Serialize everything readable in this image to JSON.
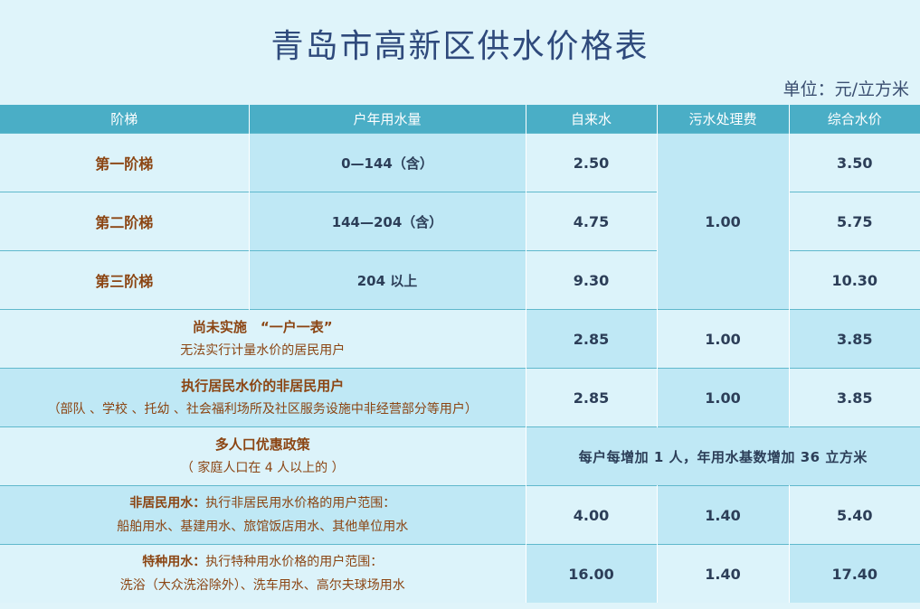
{
  "page": {
    "title": "青岛市高新区供水价格表",
    "unit": "单位：元/立方米"
  },
  "table": {
    "headers": [
      "阶梯",
      "户年用水量",
      "自来水",
      "污水处理费",
      "综合水价"
    ],
    "tiers": [
      {
        "name": "第一阶梯",
        "range": "0—144（含）",
        "tap": "2.50",
        "total": "3.50"
      },
      {
        "name": "第二阶梯",
        "range": "144—204（含）",
        "tap": "4.75",
        "total": "5.75"
      },
      {
        "name": "第三阶梯",
        "range": "204 以上",
        "tap": "9.30",
        "total": "10.30"
      }
    ],
    "tier_sewage": "1.00",
    "rows": {
      "no_meter": {
        "title": "尚未实施　“一户一表”",
        "subtitle": "无法实行计量水价的居民用户",
        "tap": "2.85",
        "sewage": "1.00",
        "total": "3.85"
      },
      "non_resident_using_resident": {
        "title": "执行居民水价的非居民用户",
        "subtitle": "（部队 、学校 、托幼 、社会福利场所及社区服务设施中非经营部分等用户）",
        "tap": "2.85",
        "sewage": "1.00",
        "total": "3.85"
      },
      "large_household": {
        "title": "多人口优惠政策",
        "subtitle": "（ 家庭人口在 4 人以上的 ）",
        "policy": "每户每增加  1 人，年用水基数增加  36 立方米"
      },
      "non_resident": {
        "label": "非居民用水：",
        "desc": "执行非居民用水价格的用户范围：",
        "examples": "船舶用水、基建用水、旅馆饭店用水、其他单位用水",
        "tap": "4.00",
        "sewage": "1.40",
        "total": "5.40"
      },
      "special": {
        "label": "特种用水：",
        "desc": "执行特种用水价格的用户范围：",
        "examples": "洗浴（大众洗浴除外）、洗车用水、高尔夫球场用水",
        "tap": "16.00",
        "sewage": "1.40",
        "total": "17.40"
      }
    }
  }
}
